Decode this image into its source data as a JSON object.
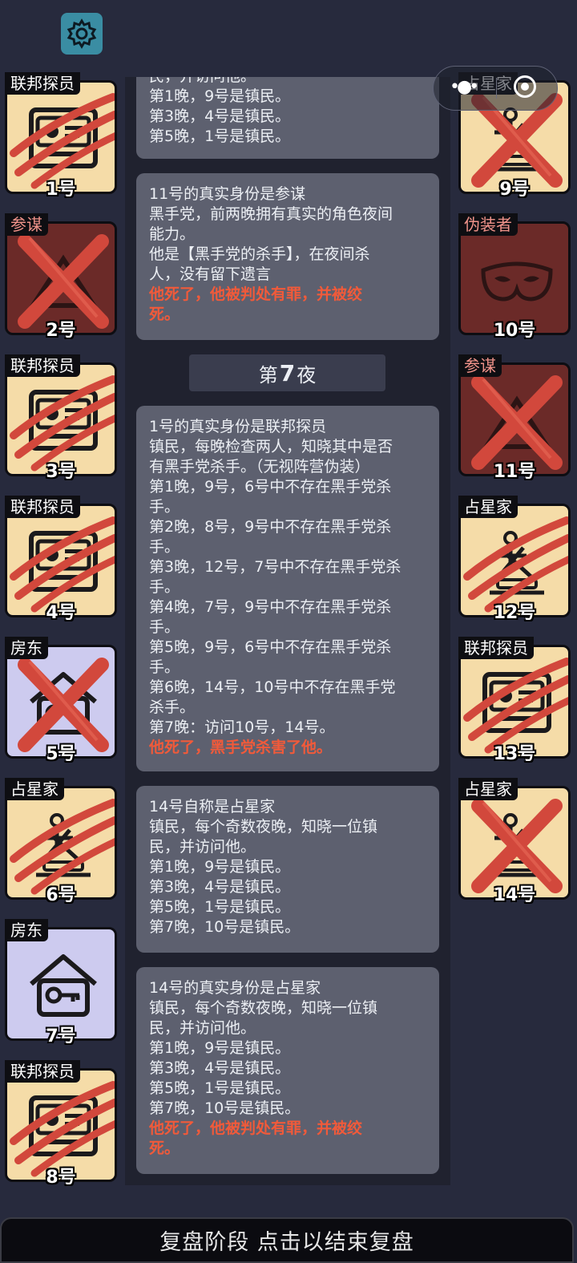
{
  "header": {
    "settings_icon": "gear-icon"
  },
  "capsule": {
    "menu_icon": "more-dots-icon",
    "close_icon": "target-circle-icon"
  },
  "players_left": [
    {
      "num": "1号",
      "role": "联邦探员",
      "bg": "#f5dca8",
      "icon": "detective-icon",
      "mark": "claw",
      "tag_red": false
    },
    {
      "num": "2号",
      "role": "参谋",
      "bg": "#6b2a28",
      "icon": "consigliere-icon",
      "mark": "cross",
      "tag_red": true
    },
    {
      "num": "3号",
      "role": "联邦探员",
      "bg": "#f5dca8",
      "icon": "detective-icon",
      "mark": "claw",
      "tag_red": false
    },
    {
      "num": "4号",
      "role": "联邦探员",
      "bg": "#f5dca8",
      "icon": "detective-icon",
      "mark": "claw",
      "tag_red": false
    },
    {
      "num": "5号",
      "role": "房东",
      "bg": "#cdcbef",
      "icon": "house-key-icon",
      "mark": "cross",
      "tag_red": false
    },
    {
      "num": "6号",
      "role": "占星家",
      "bg": "#f5dca8",
      "icon": "astrologer-icon",
      "mark": "claw",
      "tag_red": false
    },
    {
      "num": "7号",
      "role": "房东",
      "bg": "#cdcbef",
      "icon": "house-key-icon",
      "mark": "none",
      "tag_red": false
    },
    {
      "num": "8号",
      "role": "联邦探员",
      "bg": "#f5dca8",
      "icon": "detective-icon",
      "mark": "claw",
      "tag_red": false
    }
  ],
  "players_right": [
    {
      "num": "9号",
      "role": "占星家",
      "bg": "#f5dca8",
      "icon": "astrologer-icon",
      "mark": "cross",
      "tag_red": false
    },
    {
      "num": "10号",
      "role": "伪装者",
      "bg": "#6b2a28",
      "icon": "mask-icon",
      "mark": "none",
      "tag_red": true
    },
    {
      "num": "11号",
      "role": "参谋",
      "bg": "#6b2a28",
      "icon": "consigliere-icon",
      "mark": "cross",
      "tag_red": true
    },
    {
      "num": "12号",
      "role": "占星家",
      "bg": "#f5dca8",
      "icon": "astrologer-icon",
      "mark": "claw",
      "tag_red": false
    },
    {
      "num": "13号",
      "role": "联邦探员",
      "bg": "#f5dca8",
      "icon": "detective-icon",
      "mark": "claw",
      "tag_red": false
    },
    {
      "num": "14号",
      "role": "占星家",
      "bg": "#f5dca8",
      "icon": "astrologer-icon",
      "mark": "cross",
      "tag_red": false
    }
  ],
  "cards": [
    {
      "lines": [
        "民，并访问他。",
        "第1晚，9号是镇民。",
        "第3晚，4号是镇民。",
        "第5晚，1号是镇民。"
      ],
      "dead": []
    },
    {
      "lines": [
        "11号的真实身份是参谋",
        "黑手党，前两晚拥有真实的角色夜间",
        "能力。",
        "他是【黑手党的杀手】，在夜间杀",
        "人，没有留下遗言"
      ],
      "dead": [
        "他死了，他被判处有罪，并被绞",
        "死。"
      ]
    },
    {
      "lines": [
        "1号的真实身份是联邦探员",
        "镇民，每晚检查两人，知晓其中是否",
        "有黑手党杀手。（无视阵营伪装）",
        "第1晚，9号，6号中不存在黑手党杀",
        "手。",
        "第2晚，8号，9号中不存在黑手党杀",
        "手。",
        "第3晚，12号，7号中不存在黑手党杀",
        "手。",
        "第4晚，7号，9号中不存在黑手党杀",
        "手。",
        "第5晚，9号，6号中不存在黑手党杀",
        "手。",
        "第6晚，14号，10号中不存在黑手党",
        "杀手。",
        "第7晚：访问10号，14号。"
      ],
      "dead": [
        "他死了，黑手党杀害了他。"
      ]
    },
    {
      "lines": [
        "14号自称是占星家",
        "镇民，每个奇数夜晚，知晓一位镇",
        "民，并访问他。",
        "第1晚，9号是镇民。",
        "第3晚，4号是镇民。",
        "第5晚，1号是镇民。",
        "第7晚，10号是镇民。"
      ],
      "dead": []
    },
    {
      "lines": [
        "14号的真实身份是占星家",
        "镇民，每个奇数夜晚，知晓一位镇",
        "民，并访问他。",
        "第1晚，9号是镇民。",
        "第3晚，4号是镇民。",
        "第5晚，1号是镇民。",
        "第7晚，10号是镇民。"
      ],
      "dead": [
        "他死了，他被判处有罪，并被绞",
        "死。"
      ]
    }
  ],
  "night_divider": {
    "prefix": "第",
    "number": "7",
    "suffix": "夜"
  },
  "bottom_bar": {
    "label": "复盘阶段 点击以结束复盘"
  },
  "colors": {
    "background": "#272a3d",
    "card": "#5d606f",
    "death_text": "#f15a3a",
    "cream_tile": "#f5dca8",
    "mafia_tile": "#6b2a28",
    "landlord_tile": "#cdcbef",
    "mark_red": "#d2483c"
  }
}
